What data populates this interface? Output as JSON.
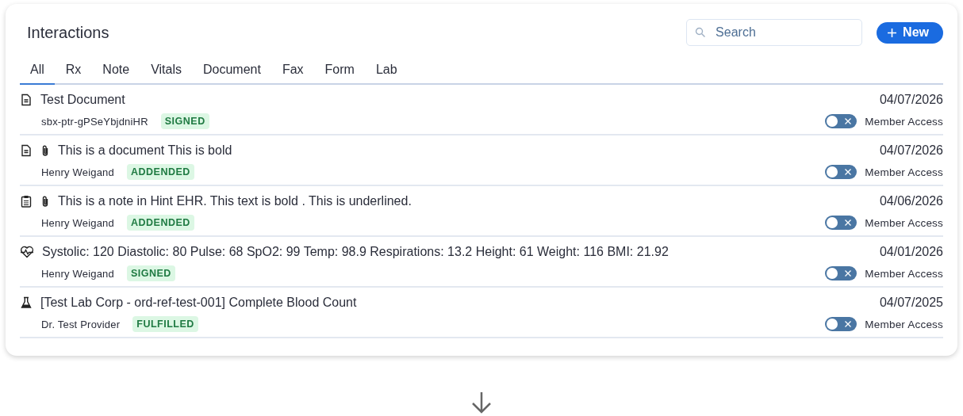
{
  "title": "Interactions",
  "search": {
    "placeholder": "Search"
  },
  "new_button": {
    "label": "New"
  },
  "tabs": [
    {
      "label": "All",
      "selected": true
    },
    {
      "label": "Rx",
      "selected": false
    },
    {
      "label": "Note",
      "selected": false
    },
    {
      "label": "Vitals",
      "selected": false
    },
    {
      "label": "Document",
      "selected": false
    },
    {
      "label": "Fax",
      "selected": false
    },
    {
      "label": "Form",
      "selected": false
    },
    {
      "label": "Lab",
      "selected": false
    }
  ],
  "rows": [
    {
      "kind": "document",
      "attachment": false,
      "title": "Test Document",
      "author": "sbx-ptr-gPSeYbjdniHR",
      "status": "SIGNED",
      "date": "04/07/2026",
      "access_label": "Member Access",
      "access_on": false
    },
    {
      "kind": "document",
      "attachment": true,
      "title": "This is a document This is bold",
      "author": "Henry Weigand",
      "status": "ADDENDED",
      "date": "04/07/2026",
      "access_label": "Member Access",
      "access_on": false
    },
    {
      "kind": "note",
      "attachment": true,
      "title": "This is a note in Hint EHR. This text is bold . This is underlined.",
      "author": "Henry Weigand",
      "status": "ADDENDED",
      "date": "04/06/2026",
      "access_label": "Member Access",
      "access_on": false
    },
    {
      "kind": "vitals",
      "attachment": false,
      "title": "Systolic: 120 Diastolic: 80 Pulse: 68 SpO2: 99 Temp: 98.9 Respirations: 13.2 Height: 61 Weight: 116 BMI: 21.92",
      "author": "Henry Weigand",
      "status": "SIGNED",
      "date": "04/01/2026",
      "access_label": "Member Access",
      "access_on": false
    },
    {
      "kind": "lab",
      "attachment": false,
      "title": "[Test Lab Corp - ord-ref-test-001] Complete Blood Count",
      "author": "Dr. Test Provider",
      "status": "FULFILLED",
      "date": "04/07/2025",
      "access_label": "Member Access",
      "access_on": false
    }
  ]
}
